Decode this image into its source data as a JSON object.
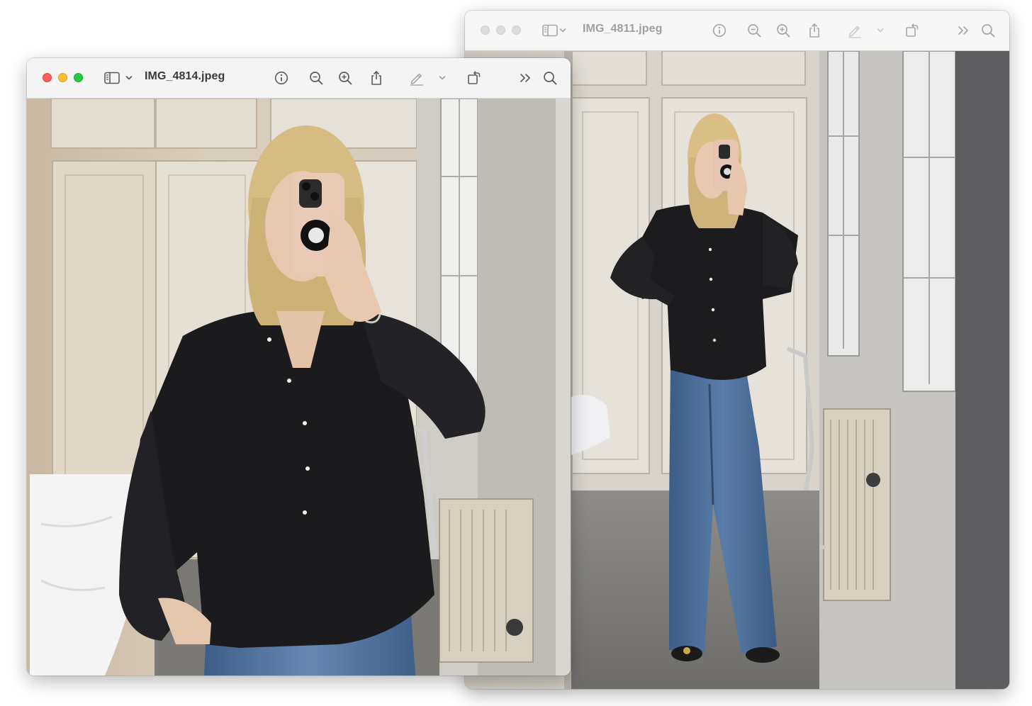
{
  "windows": {
    "front": {
      "title": "IMG_4814.jpeg",
      "state": "active",
      "photo": "woman-mirror-selfie-black-shirt-closeup"
    },
    "back": {
      "title": "IMG_4811.jpeg",
      "state": "inactive",
      "photo": "woman-mirror-selfie-black-shirt-wide-leg-jeans-full-length"
    }
  },
  "toolbar_icons": [
    "sidebar-toggle-icon",
    "chevron-down-icon",
    "info-icon",
    "zoom-out-icon",
    "zoom-in-icon",
    "share-icon",
    "markup-pen-icon",
    "rotate-icon",
    "more-icon",
    "search-icon"
  ],
  "colors": {
    "close": "#fe5f57",
    "minimize": "#febc2e",
    "zoom": "#28c840",
    "inactive_light": "#dcdcdc",
    "titlebar": "#f4f4f4"
  }
}
